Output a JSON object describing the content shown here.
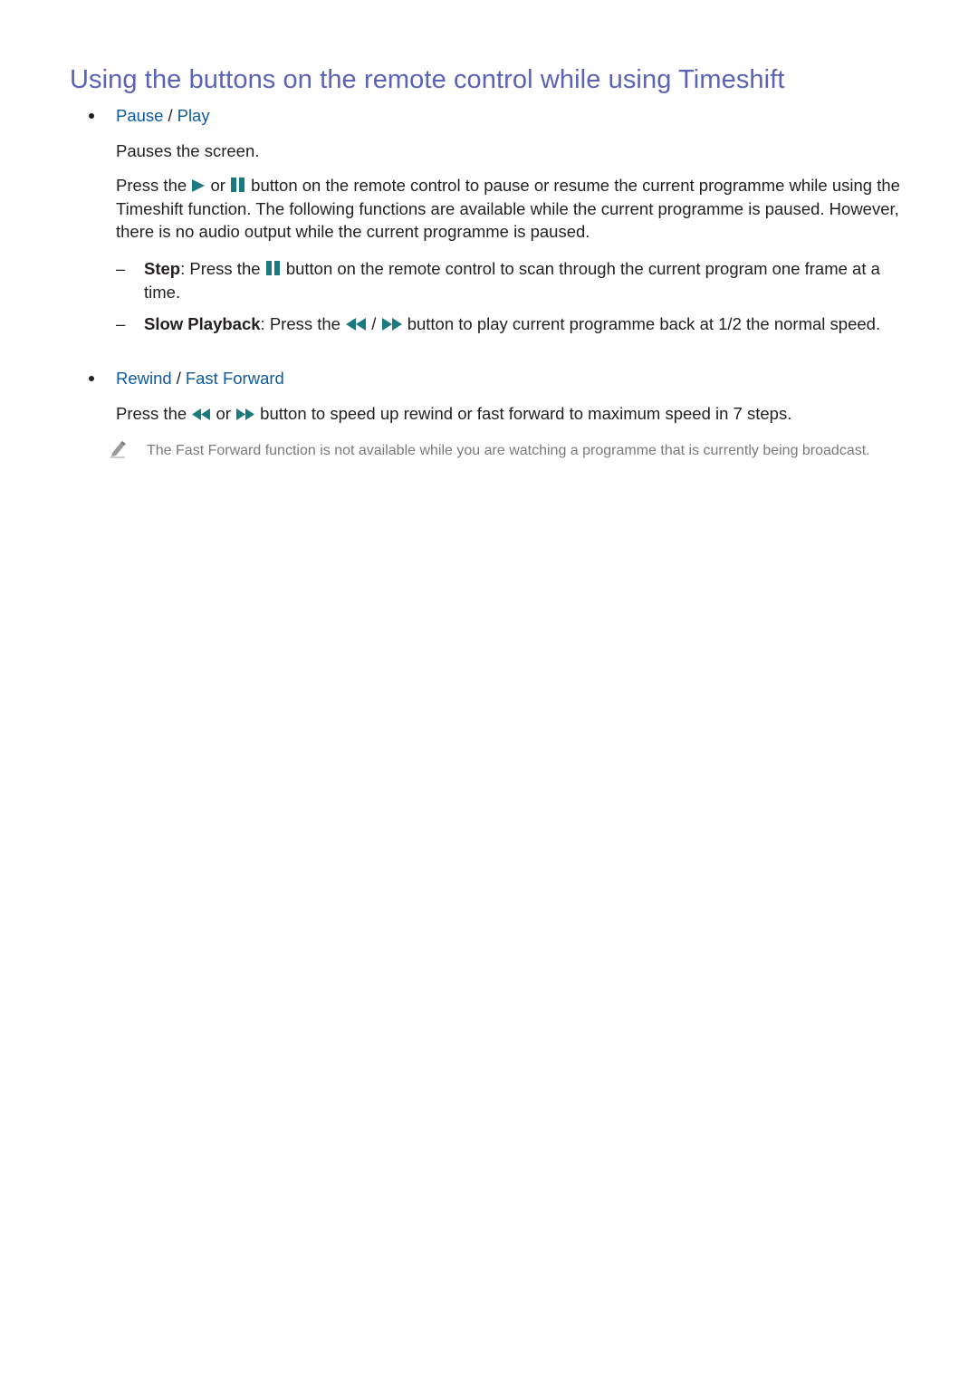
{
  "heading": "Using the buttons on the remote control while using Timeshift",
  "colors": {
    "heading": "#5b63b7",
    "link": "#0f5aa1",
    "icon": "#1b7a80",
    "body_text": "#231f20",
    "note_text": "#7a7a7a"
  },
  "sections": [
    {
      "links": [
        "Pause",
        "Play"
      ],
      "separator": "/",
      "summary": "Pauses the screen.",
      "description": {
        "before_icon1": "Press the",
        "icon1": "play-icon",
        "between": "or",
        "icon2": "pause-icon",
        "after": "button on the remote control to pause or resume the current programme while using the Timeshift function. The following functions are available while the current programme is paused. However, there is no audio output while the current programme is paused."
      },
      "sub_items": [
        {
          "dash": "–",
          "label": "Step",
          "colon": ":",
          "before_icon": "Press the",
          "icon": "pause-icon",
          "after": "button on the remote control to scan through the current program one frame at a time."
        },
        {
          "dash": "–",
          "label": "Slow Playback",
          "colon": ":",
          "before_icon": "Press the",
          "icon1": "rewind-icon",
          "between": "/",
          "icon2": "fast-forward-icon",
          "after": "button to play current programme back at 1/2 the normal speed."
        }
      ]
    },
    {
      "links": [
        "Rewind",
        "Fast Forward"
      ],
      "separator": "/",
      "description": {
        "before_icon1": "Press the",
        "icon1": "rewind-icon",
        "between": "or",
        "icon2": "fast-forward-icon",
        "after": "button to speed up rewind or fast forward to maximum speed in 7 steps."
      },
      "note": {
        "icon": "pencil-note-icon",
        "text": "The Fast Forward function is not available while you are watching a programme that is currently being broadcast."
      }
    }
  ]
}
